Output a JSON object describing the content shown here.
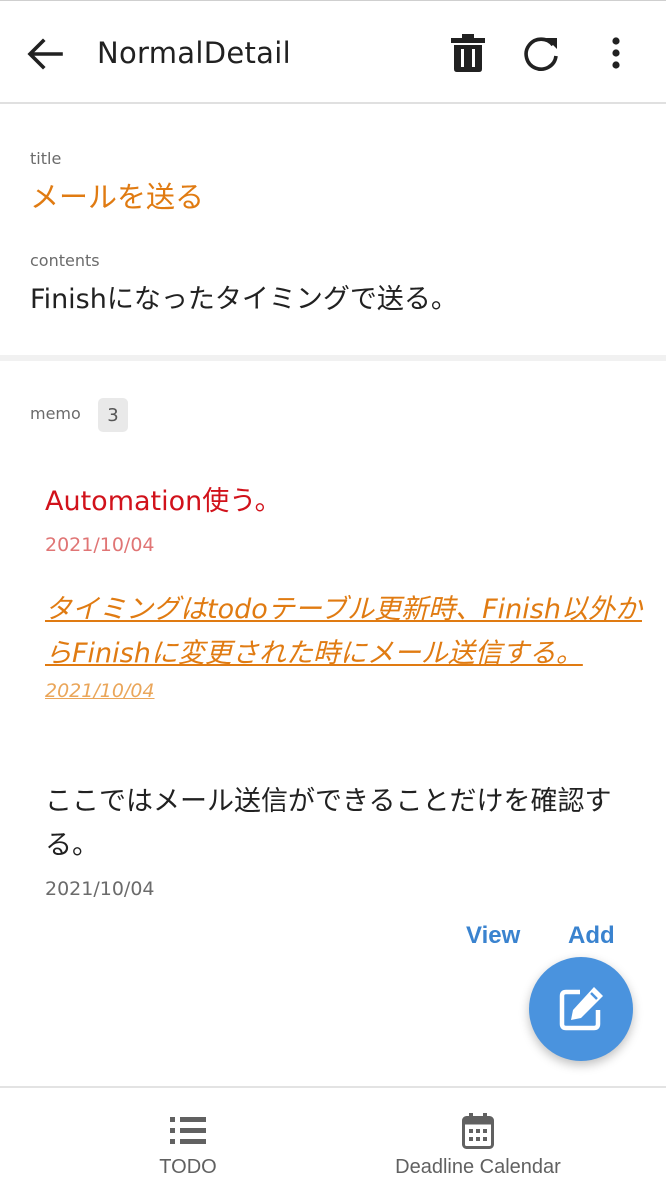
{
  "app_bar": {
    "title": "NormalDetail",
    "back_icon": "arrow-left-icon",
    "actions": [
      {
        "icon": "trash-icon"
      },
      {
        "icon": "refresh-icon"
      },
      {
        "icon": "more-vert-icon"
      }
    ]
  },
  "detail": {
    "title_label": "title",
    "title_value": "メールを送る",
    "contents_label": "contents",
    "contents_value": "Finishになったタイミングで送る。"
  },
  "memo": {
    "label": "memo",
    "count": "3",
    "items": [
      {
        "text": "Automation使う。",
        "date": "2021/10/04",
        "color": "#d1121b"
      },
      {
        "text": "タイミングはtodoテーブル更新時、Finish以外からFinishに変更された時にメール送信する。",
        "date": "2021/10/04",
        "color": "#e07b12"
      },
      {
        "text": "ここではメール送信ができることだけを確認する。",
        "date": "2021/10/04",
        "color": "#212121"
      }
    ],
    "view_label": "View",
    "add_label": "Add"
  },
  "fab": {
    "icon": "edit-icon",
    "color": "#4a93de"
  },
  "bottom_nav": {
    "items": [
      {
        "label": "TODO",
        "icon": "list-icon"
      },
      {
        "label": "Deadline Calendar",
        "icon": "calendar-icon"
      }
    ]
  },
  "colors": {
    "accent": "#e07b12",
    "link": "#3a83cf",
    "memo_red": "#d1121b"
  }
}
